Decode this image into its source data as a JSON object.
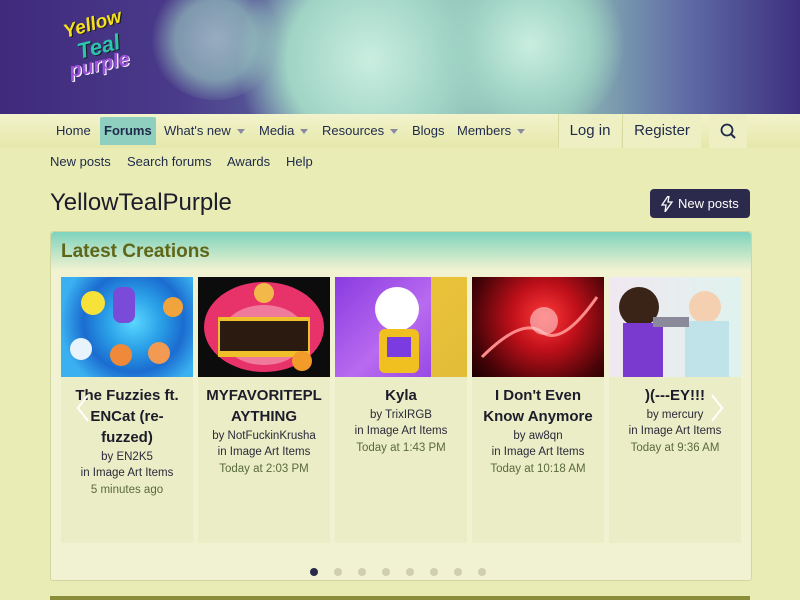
{
  "site": {
    "logo_lines": [
      "Yellow",
      "Teal",
      "purple"
    ]
  },
  "nav": {
    "tabs": [
      {
        "label": "Home",
        "selected": false,
        "has_menu": false
      },
      {
        "label": "Forums",
        "selected": true,
        "has_menu": false
      },
      {
        "label": "What's new",
        "selected": false,
        "has_menu": true
      },
      {
        "label": "Media",
        "selected": false,
        "has_menu": true
      },
      {
        "label": "Resources",
        "selected": false,
        "has_menu": true
      },
      {
        "label": "Blogs",
        "selected": false,
        "has_menu": false
      },
      {
        "label": "Members",
        "selected": false,
        "has_menu": true
      }
    ],
    "login_label": "Log in",
    "register_label": "Register",
    "search_icon": "search-icon"
  },
  "subnav": {
    "items": [
      "New posts",
      "Search forums",
      "Awards",
      "Help"
    ]
  },
  "page": {
    "title": "YellowTealPurple",
    "new_posts_button": "New posts"
  },
  "latest": {
    "heading": "Latest Creations",
    "cards": [
      {
        "title": "The Fuzzies ft. ENCat (re-fuzzed)",
        "by": "by EN2K5",
        "in": "in Image Art Items",
        "time": "5 minutes ago"
      },
      {
        "title": "MYFAVORITEPLAYTHING",
        "by": "by NotFuckinKrusha",
        "in": "in Image Art Items",
        "time": "Today at 2:03 PM"
      },
      {
        "title": "Kyla",
        "by": "by TrixIRGB",
        "in": "in Image Art Items",
        "time": "Today at 1:43 PM"
      },
      {
        "title": "I Don't Even Know Anymore",
        "by": "by aw8qn",
        "in": "in Image Art Items",
        "time": "Today at 10:18 AM"
      },
      {
        "title": ")(---EY!!!",
        "by": "by mercury",
        "in": "in Image Art Items",
        "time": "Today at 9:36 AM"
      }
    ],
    "pager": {
      "count": 8,
      "active": 1
    },
    "colors": {
      "accent": "#2b2a4c",
      "teal": "#8fcfbf",
      "heading": "#5f6618"
    }
  }
}
